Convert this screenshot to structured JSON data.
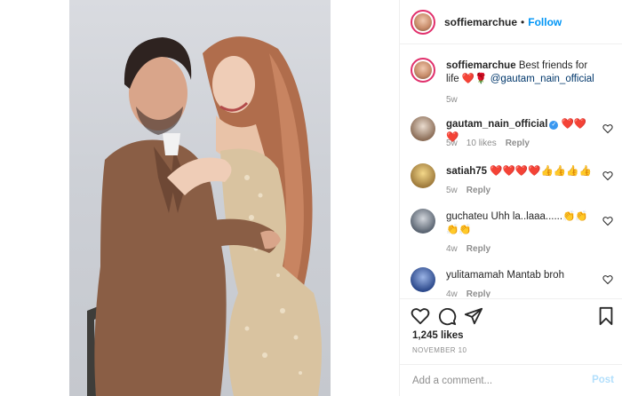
{
  "header": {
    "username": "soffiemarchue",
    "separator": "•",
    "follow_label": "Follow"
  },
  "caption": {
    "username": "soffiemarchue",
    "text": "Best friends for life",
    "emoji": "❤️🌹",
    "mention": "@gautam_nain_official",
    "time": "5w"
  },
  "comments": [
    {
      "username": "gautam_nain_official",
      "text": "❤️❤️❤️",
      "time": "5w",
      "likes": "10 likes",
      "reply": "Reply",
      "verified": true
    },
    {
      "username": "satiah75",
      "text": "❤️❤️❤️❤️👍👍👍👍",
      "time": "5w",
      "reply": "Reply"
    },
    {
      "username": "guchateu",
      "text": "Uhh la..laaa......👏👏👏👏",
      "time": "4w",
      "reply": "Reply"
    },
    {
      "username": "yulitamamah",
      "text": "Mantab broh",
      "time": "4w",
      "reply": "Reply"
    }
  ],
  "post": {
    "likes": "1,245 likes",
    "date": "NOVEMBER 10"
  },
  "add_comment": {
    "placeholder": "Add a comment...",
    "post_label": "Post"
  },
  "colors": {
    "follow": "#0095f6",
    "heart": "#ed4956",
    "mention": "#00376b",
    "muted": "#8e8e8e",
    "post_disabled": "#b2dffc"
  },
  "icons": [
    "heart-icon",
    "comment-icon",
    "share-icon",
    "bookmark-icon",
    "verified-icon",
    "like-heart-icon"
  ]
}
